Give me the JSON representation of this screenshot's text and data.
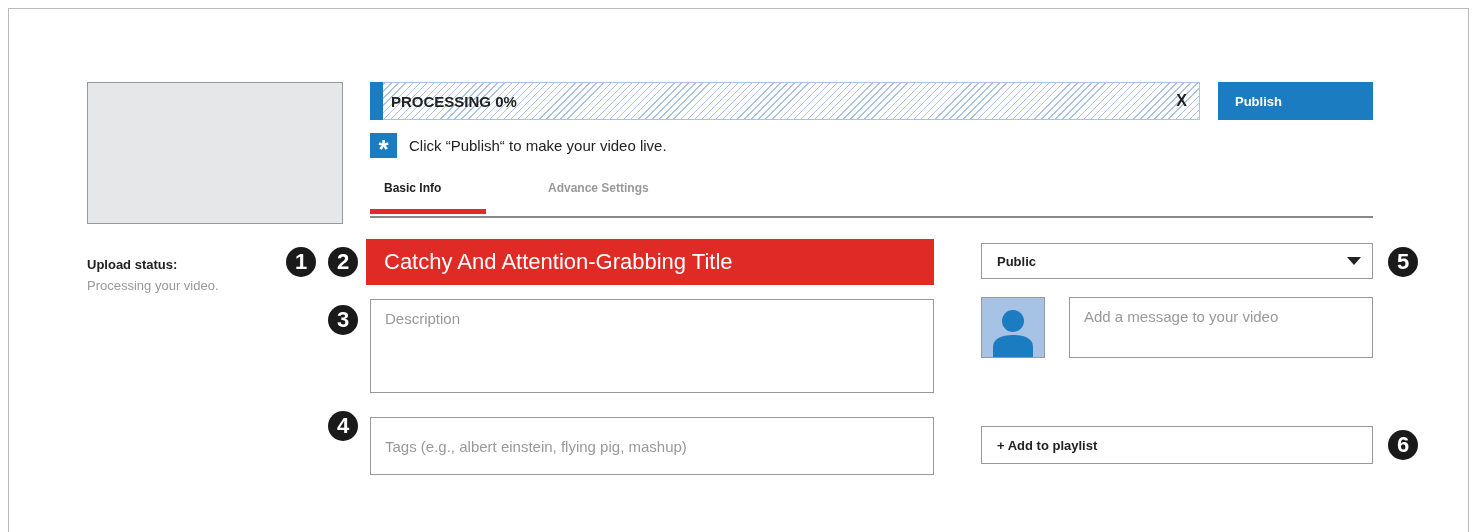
{
  "upload_status": {
    "label": "Upload status:",
    "detail": "Processing your video."
  },
  "progress": {
    "label": "PROCESSING 0%",
    "level": 0,
    "close": "X"
  },
  "publish_button": "Publish",
  "notice": {
    "icon": "*",
    "text": "Click “Publish“ to make your video live."
  },
  "tabs": [
    {
      "label": "Basic Info",
      "selected": true
    },
    {
      "label": "Advance Settings",
      "selected": false
    }
  ],
  "title_field": {
    "markers": [
      "1",
      "2"
    ],
    "value": "Catchy And Attention-Grabbing Title"
  },
  "description": {
    "marker": "3",
    "placeholder": "Description"
  },
  "tags": {
    "marker": "4",
    "placeholder": "Tags (e.g., albert einstein, flying pig, mashup)"
  },
  "privacy": {
    "marker": "5",
    "value": "Public"
  },
  "message": {
    "placeholder": "Add a message to your video"
  },
  "playlist_button": {
    "marker": "6",
    "label": "+ Add to playlist"
  }
}
